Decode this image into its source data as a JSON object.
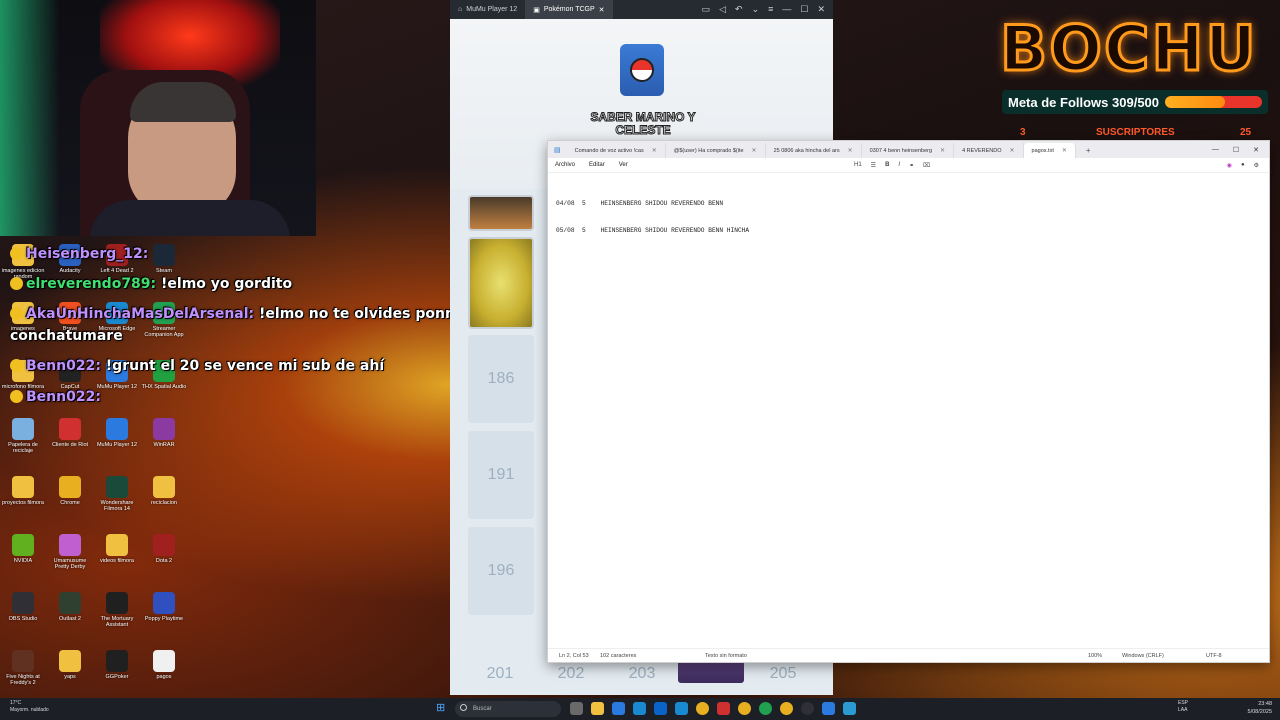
{
  "overlay": {
    "logo_text": "BOCHU",
    "follow_goal_label": "Meta de Follows 309/500",
    "follow_goal_progress": 0.618,
    "subs_label": "SUSCRIPTORES",
    "subs_count": "25",
    "subs_left": "3"
  },
  "chat": [
    {
      "user": "Heisenberg_12:",
      "message": ""
    },
    {
      "user": "elreverendo789:",
      "message": "!elmo yo gordito"
    },
    {
      "user": "AkaUnHinchaMasDelArsenal:",
      "message": "!elmo no te olvides ponme a mi"
    },
    {
      "user": "",
      "message": "conchatumare"
    },
    {
      "user": "Benn022:",
      "message": "!grunt el 20 se vence mi sub de ahí"
    },
    {
      "user": "Benn022:",
      "message": ""
    }
  ],
  "desktop_icons": [
    {
      "label": "imagenes edicion random",
      "icon": "folder-icon",
      "color": "#f0c040"
    },
    {
      "label": "Audacity",
      "icon": "audacity-icon",
      "color": "#2a60c0"
    },
    {
      "label": "Left 4 Dead 2",
      "icon": "game-icon",
      "color": "#a02020"
    },
    {
      "label": "Steam",
      "icon": "steam-icon",
      "color": "#1b2838"
    },
    {
      "label": "imagenes",
      "icon": "folder-icon",
      "color": "#f0c040"
    },
    {
      "label": "Brave",
      "icon": "brave-icon",
      "color": "#f05020"
    },
    {
      "label": "Microsoft Edge",
      "icon": "edge-icon",
      "color": "#1a8ad0"
    },
    {
      "label": "Streamer Companion App",
      "icon": "streamer-icon",
      "color": "#20a050"
    },
    {
      "label": "microfono filmora",
      "icon": "folder-icon",
      "color": "#f0c040"
    },
    {
      "label": "CapCut",
      "icon": "capcut-icon",
      "color": "#222222"
    },
    {
      "label": "MuMu Player 12",
      "icon": "mumu-icon",
      "color": "#2a7ae0"
    },
    {
      "label": "THX Spatial Audio",
      "icon": "thx-icon",
      "color": "#20a040"
    },
    {
      "label": "Papelera de reciclaje",
      "icon": "recycle-bin-icon",
      "color": "#7ab0e0"
    },
    {
      "label": "Cliente de Riot",
      "icon": "riot-icon",
      "color": "#d03030"
    },
    {
      "label": "MuMu Player 12",
      "icon": "mumu-icon",
      "color": "#2a7ae0"
    },
    {
      "label": "WinRAR",
      "icon": "winrar-icon",
      "color": "#8a3aa0"
    },
    {
      "label": "proyectos filmora",
      "icon": "folder-icon",
      "color": "#f0c040"
    },
    {
      "label": "Chrome",
      "icon": "chrome-icon",
      "color": "#e8b020"
    },
    {
      "label": "Wondershare Filmora 14",
      "icon": "filmora-icon",
      "color": "#1a4a3a"
    },
    {
      "label": "reciclacion",
      "icon": "folder-icon",
      "color": "#f0c040"
    },
    {
      "label": "NVIDIA",
      "icon": "nvidia-icon",
      "color": "#60b020"
    },
    {
      "label": "Umamusume Pretty Derby",
      "icon": "umamusume-icon",
      "color": "#c060d0"
    },
    {
      "label": "videos filmora",
      "icon": "folder-icon",
      "color": "#f0c040"
    },
    {
      "label": "Dota 2",
      "icon": "dota-icon",
      "color": "#a02020"
    },
    {
      "label": "OBS Studio",
      "icon": "obs-icon",
      "color": "#302f35"
    },
    {
      "label": "Outlast 2",
      "icon": "outlast-icon",
      "color": "#304030"
    },
    {
      "label": "The Mortuary Assistant",
      "icon": "game-icon",
      "color": "#202020"
    },
    {
      "label": "Poppy Playtime",
      "icon": "poppy-icon",
      "color": "#3050c0"
    },
    {
      "label": "Five Nights at Freddy's 2",
      "icon": "fnaf-icon",
      "color": "#603020"
    },
    {
      "label": "yaps",
      "icon": "folder-icon",
      "color": "#f0c040"
    },
    {
      "label": "GGPoker",
      "icon": "ggpoker-icon",
      "color": "#202020"
    },
    {
      "label": "pagos",
      "icon": "document-icon",
      "color": "#f0f0f0"
    }
  ],
  "mumu": {
    "tab_player": "MuMu Player 12",
    "tab_game": "Pokémon TCGP",
    "banner": "SABER MARINO Y CELESTE",
    "grid_numbers": [
      "186",
      "191",
      "196"
    ],
    "bottom_numbers": [
      "201",
      "202",
      "203",
      "205"
    ]
  },
  "notepad": {
    "tabs": [
      {
        "label": "Comando de voz activo !cas"
      },
      {
        "label": "@$(user) Ha comprado $(ite"
      },
      {
        "label": "25   0806 aka hincha del ars"
      },
      {
        "label": "0307   4 benn heinsenberg"
      },
      {
        "label": "4      REVERENDO"
      },
      {
        "label": "pagos.txt"
      }
    ],
    "menu": {
      "archivo": "Archivo",
      "editar": "Editar",
      "ver": "Ver",
      "heading": "H1"
    },
    "lines": [
      "04/08  5    HEINSENBERG SHIDOU REVERENDO BENN",
      "05/08  5    HEINSENBERG SHIDOU REVERENDO BENN HINCHA"
    ],
    "status": {
      "position": "Ln 2, Col 53",
      "chars": "102 caracteres",
      "format": "Texto sin formato",
      "zoom": "100%",
      "eol": "Windows (CRLF)",
      "encoding": "UTF-8"
    }
  },
  "taskbar": {
    "weather_temp": "17°C",
    "weather_desc": "Mayorm. nublado",
    "search_placeholder": "Buscar",
    "lang_1": "ESP",
    "lang_2": "LAA",
    "time": "23:48",
    "date": "5/08/2025"
  }
}
